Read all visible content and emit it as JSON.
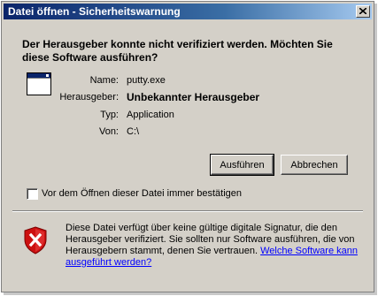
{
  "window": {
    "title": "Datei öffnen - Sicherheitswarnung",
    "close_icon": "close-icon"
  },
  "question": "Der Herausgeber konnte nicht verifiziert werden. Möchten Sie diese Software ausführen?",
  "details": {
    "icon": "application-window-icon",
    "name_label": "Name:",
    "name_value": "putty.exe",
    "publisher_label": "Herausgeber:",
    "publisher_value": "Unbekannter Herausgeber",
    "type_label": "Typ:",
    "type_value": "Application",
    "from_label": "Von:",
    "from_value": "C:\\"
  },
  "buttons": {
    "run": "Ausführen",
    "cancel": "Abbrechen"
  },
  "checkbox": {
    "label": "Vor dem Öffnen dieser Datei immer bestätigen",
    "checked": false
  },
  "warning": {
    "icon": "security-shield-icon",
    "text": "Diese Datei verfügt über keine gültige digitale Signatur, die den Herausgeber verifiziert. Sie sollten nur Software ausführen, die von Herausgebern stammt, denen Sie vertrauen.",
    "link": "Welche Software kann ausgeführt werden?"
  },
  "colors": {
    "titlebar_start": "#0a246a",
    "titlebar_end": "#a6caf0",
    "dialog_bg": "#d4d0c8",
    "shield_red": "#cc1010",
    "link": "#0000ff"
  }
}
